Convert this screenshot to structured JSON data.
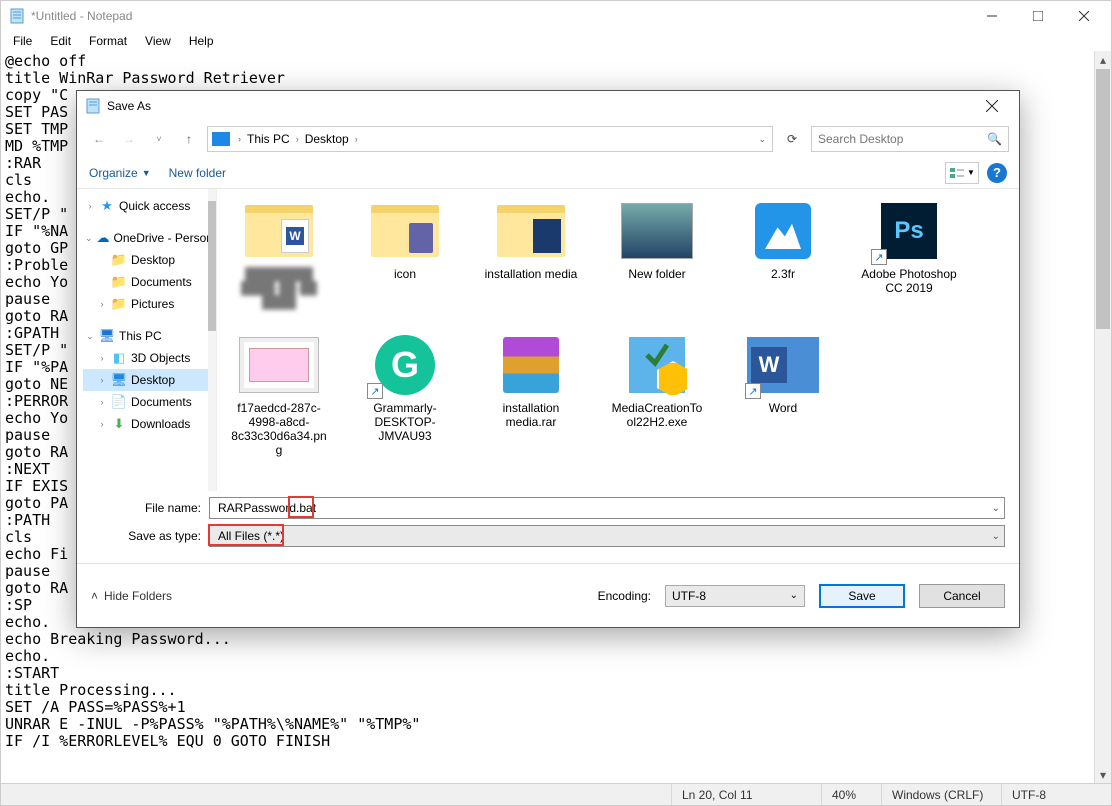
{
  "notepad": {
    "title": "*Untitled - Notepad",
    "menu": [
      "File",
      "Edit",
      "Format",
      "View",
      "Help"
    ],
    "content": "@echo off\ntitle WinRar Password Retriever\ncopy \"C\nSET PAS\nSET TMP\nMD %TMP\n:RAR\ncls\necho.\nSET/P \"\nIF \"%NA\ngoto GP\n:Proble\necho Yo\npause\ngoto RA\n:GPATH\nSET/P \"\nIF \"%PA\ngoto NE\n:PERROR\necho Yo\npause\ngoto RA\n:NEXT\nIF EXIS\ngoto PA\n:PATH\ncls\necho Fi\npause\ngoto RA\n:SP\necho.\necho Breaking Password...\necho.\n:START\ntitle Processing...\nSET /A PASS=%PASS%+1\nUNRAR E -INUL -P%PASS% \"%PATH%\\%NAME%\" \"%TMP%\"\nIF /I %ERRORLEVEL% EQU 0 GOTO FINISH",
    "status": {
      "pos": "Ln 20, Col 11",
      "zoom": "40%",
      "eol": "Windows (CRLF)",
      "enc": "UTF-8"
    }
  },
  "dialog": {
    "title": "Save As",
    "breadcrumb": {
      "root": "This PC",
      "folder": "Desktop"
    },
    "search_placeholder": "Search Desktop",
    "toolbar": {
      "organize": "Organize",
      "newfolder": "New folder"
    },
    "tree": {
      "quick": "Quick access",
      "onedrive": "OneDrive - Personal",
      "od_desktop": "Desktop",
      "od_documents": "Documents",
      "od_pictures": "Pictures",
      "thispc": "This PC",
      "pc_3d": "3D Objects",
      "pc_desktop": "Desktop",
      "pc_documents": "Documents",
      "pc_downloads": "Downloads"
    },
    "files": {
      "f1": "",
      "f2": "icon",
      "f3": "installation media",
      "f4": "New folder",
      "f5": "2.3fr",
      "f6": "Adobe Photoshop CC 2019",
      "f7": "f17aedcd-287c-4998-a8cd-8c33c30d6a34.png",
      "f8": "Grammarly-DESKTOP-JMVAU93",
      "f9": "installation media.rar",
      "f10": "MediaCreationTool22H2.exe",
      "f11": "Word"
    },
    "filename_label": "File name:",
    "filetype_label": "Save as type:",
    "filename_value": "RARPassword.bat",
    "filetype_value": "All Files  (*.*)",
    "hide_folders": "Hide Folders",
    "encoding_label": "Encoding:",
    "encoding_value": "UTF-8",
    "save": "Save",
    "cancel": "Cancel"
  }
}
